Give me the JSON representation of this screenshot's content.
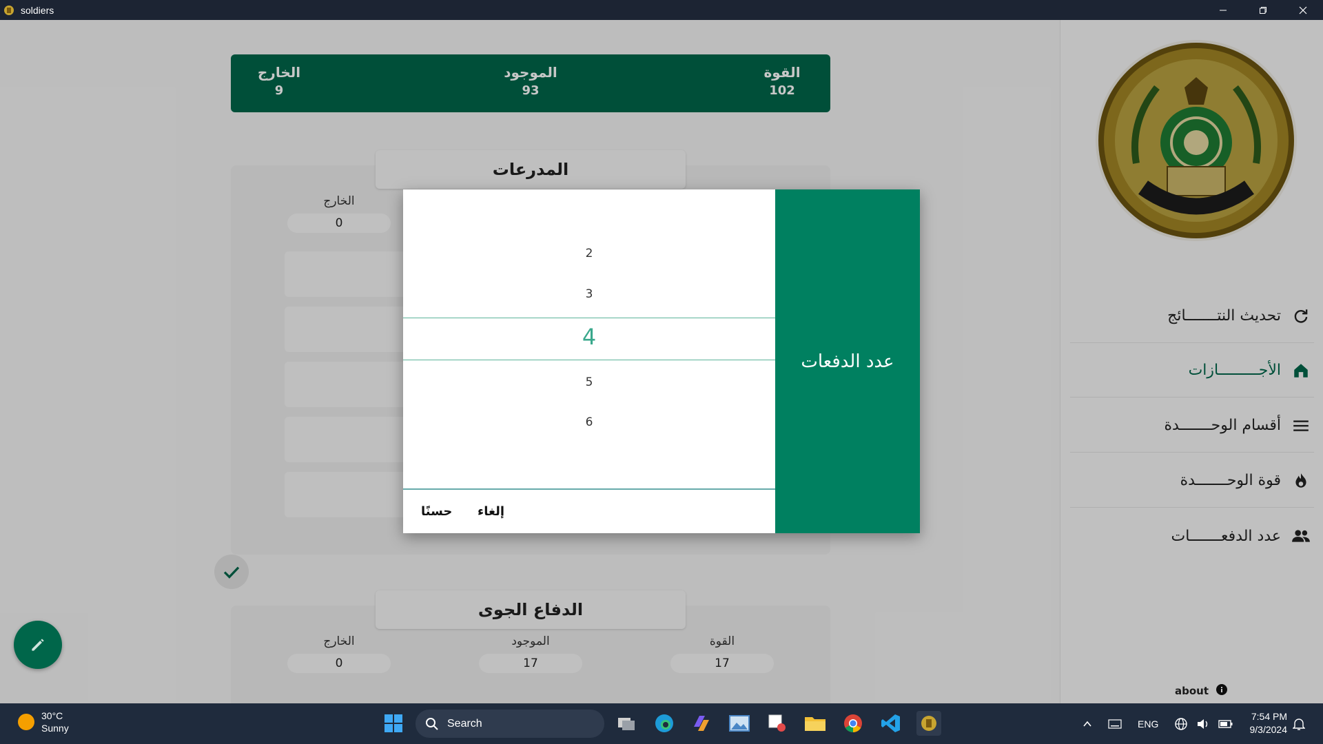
{
  "window": {
    "title": "soldiers"
  },
  "summary": {
    "strength_label": "القوة",
    "strength_value": "102",
    "present_label": "الموجود",
    "present_value": "93",
    "out_label": "الخارج",
    "out_value": "9"
  },
  "card1": {
    "title": "المدرعات",
    "out_label": "الخارج",
    "out_value": "0"
  },
  "card2": {
    "title": "الدفاع الجوى",
    "out_label": "الخارج",
    "out_value": "0",
    "present_label": "الموجود",
    "present_value": "17",
    "strength_label": "القوة",
    "strength_value": "17"
  },
  "sidebar": {
    "items": [
      {
        "label": "تحديث النتـــــــائج",
        "icon": "refresh-icon"
      },
      {
        "label": "الأجـــــــــازات",
        "icon": "home-icon"
      },
      {
        "label": "أقسام الوحـــــــدة",
        "icon": "menu-icon"
      },
      {
        "label": "قوة الوحـــــــدة",
        "icon": "fire-icon"
      },
      {
        "label": "عدد الدفعـــــــات",
        "icon": "people-icon"
      }
    ],
    "about_label": "about"
  },
  "dialog": {
    "title": "عدد الدفعات",
    "picker_values": [
      "2",
      "3",
      "4",
      "5",
      "6"
    ],
    "selected": "4",
    "ok_label": "حسنًا",
    "cancel_label": "إلغاء"
  },
  "taskbar": {
    "weather_temp": "30°C",
    "weather_desc": "Sunny",
    "search_label": "Search",
    "lang": "ENG",
    "time": "7:54 PM",
    "date": "9/3/2024"
  },
  "colors": {
    "primary": "#00664a",
    "accent": "#008060",
    "picker_selected": "#3aa88c"
  }
}
